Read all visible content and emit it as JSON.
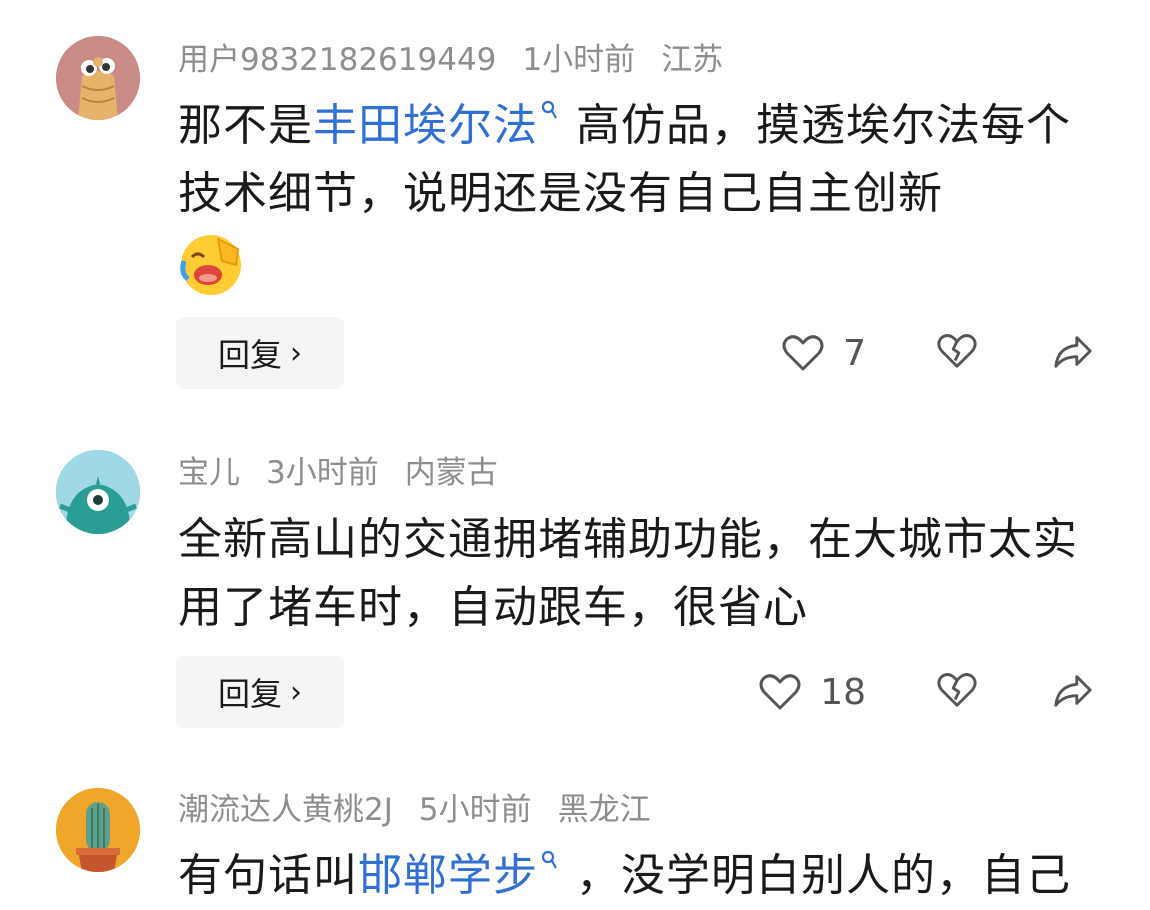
{
  "comments": [
    {
      "user": "用户9832182619449",
      "time": "1小时前",
      "location": "江苏",
      "text_pre": "那不是",
      "link": "丰田埃尔法",
      "text_post": "高仿品，摸透埃尔法每个技术细节，说明还是没有自己自主创新",
      "reply_label": "回复",
      "likes": "7",
      "avatar_icon": "cartoon-creature-avatar-icon",
      "avatar_bg": "#c98b86"
    },
    {
      "user": "宝儿",
      "time": "3小时前",
      "location": "内蒙古",
      "text": "全新高山的交通拥堵辅助功能，在大城市太实用了堵车时，自动跟车，很省心",
      "reply_label": "回复",
      "likes": "18",
      "avatar_icon": "teal-monster-avatar-icon",
      "avatar_bg": "#2fa39b"
    },
    {
      "user": "潮流达人黄桃2J",
      "time": "5小时前",
      "location": "黑龙江",
      "text_pre": "有句话叫",
      "link": "邯郸学步",
      "text_post": "，没学明白别人的，自己",
      "avatar_icon": "cactus-avatar-icon",
      "avatar_bg": "#f0a62a"
    }
  ],
  "colors": {
    "link": "#2f6fd6",
    "meta": "#8e8e8e",
    "reply_bg": "#f5f5f5"
  },
  "icons": {
    "like": "heart-icon",
    "dislike": "broken-heart-icon",
    "share": "share-arrow-icon",
    "search": "search-icon",
    "emoji": "laughing-crying-emoji"
  }
}
